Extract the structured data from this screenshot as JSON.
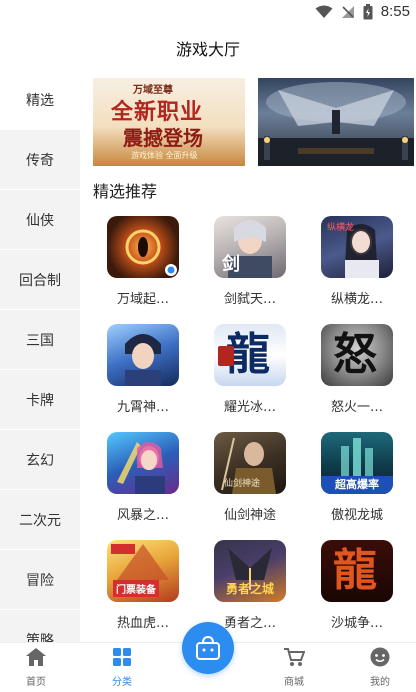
{
  "status": {
    "time": "8:55"
  },
  "title": "游戏大厅",
  "sidebar": {
    "items": [
      {
        "label": "精选"
      },
      {
        "label": "传奇"
      },
      {
        "label": "仙侠"
      },
      {
        "label": "回合制"
      },
      {
        "label": "三国"
      },
      {
        "label": "卡牌"
      },
      {
        "label": "玄幻"
      },
      {
        "label": "二次元"
      },
      {
        "label": "冒险"
      },
      {
        "label": "策略"
      }
    ]
  },
  "banners": [
    {
      "brand": "万域至尊",
      "headline1": "全新职业",
      "headline2": "震撼登场",
      "tagline": "游戏体验 全面升级"
    },
    {
      "caption": ""
    }
  ],
  "section_title": "精选推荐",
  "games": [
    {
      "name": "万域起…",
      "icon_text": ""
    },
    {
      "name": "剑弑天…",
      "icon_text": "剑"
    },
    {
      "name": "纵横龙…",
      "icon_text": "纵横龙"
    },
    {
      "name": "九霄神…",
      "icon_text": ""
    },
    {
      "name": "耀光冰…",
      "icon_text": "龍"
    },
    {
      "name": "怒火一…",
      "icon_text": "怒"
    },
    {
      "name": "风暴之…",
      "icon_text": ""
    },
    {
      "name": "仙剑神途",
      "icon_text": "仙剑神途"
    },
    {
      "name": "傲视龙城",
      "icon_text": "超高爆率"
    },
    {
      "name": "热血虎…",
      "icon_text": "门票装备"
    },
    {
      "name": "勇者之…",
      "icon_text": "勇者之城"
    },
    {
      "name": "沙城争…",
      "icon_text": "龍"
    }
  ],
  "nav": {
    "home": "首页",
    "category": "分类",
    "mall": "商城",
    "mine": "我的"
  },
  "colors": {
    "accent": "#2d8cf0",
    "sidebar_bg": "#f3f3f3"
  }
}
